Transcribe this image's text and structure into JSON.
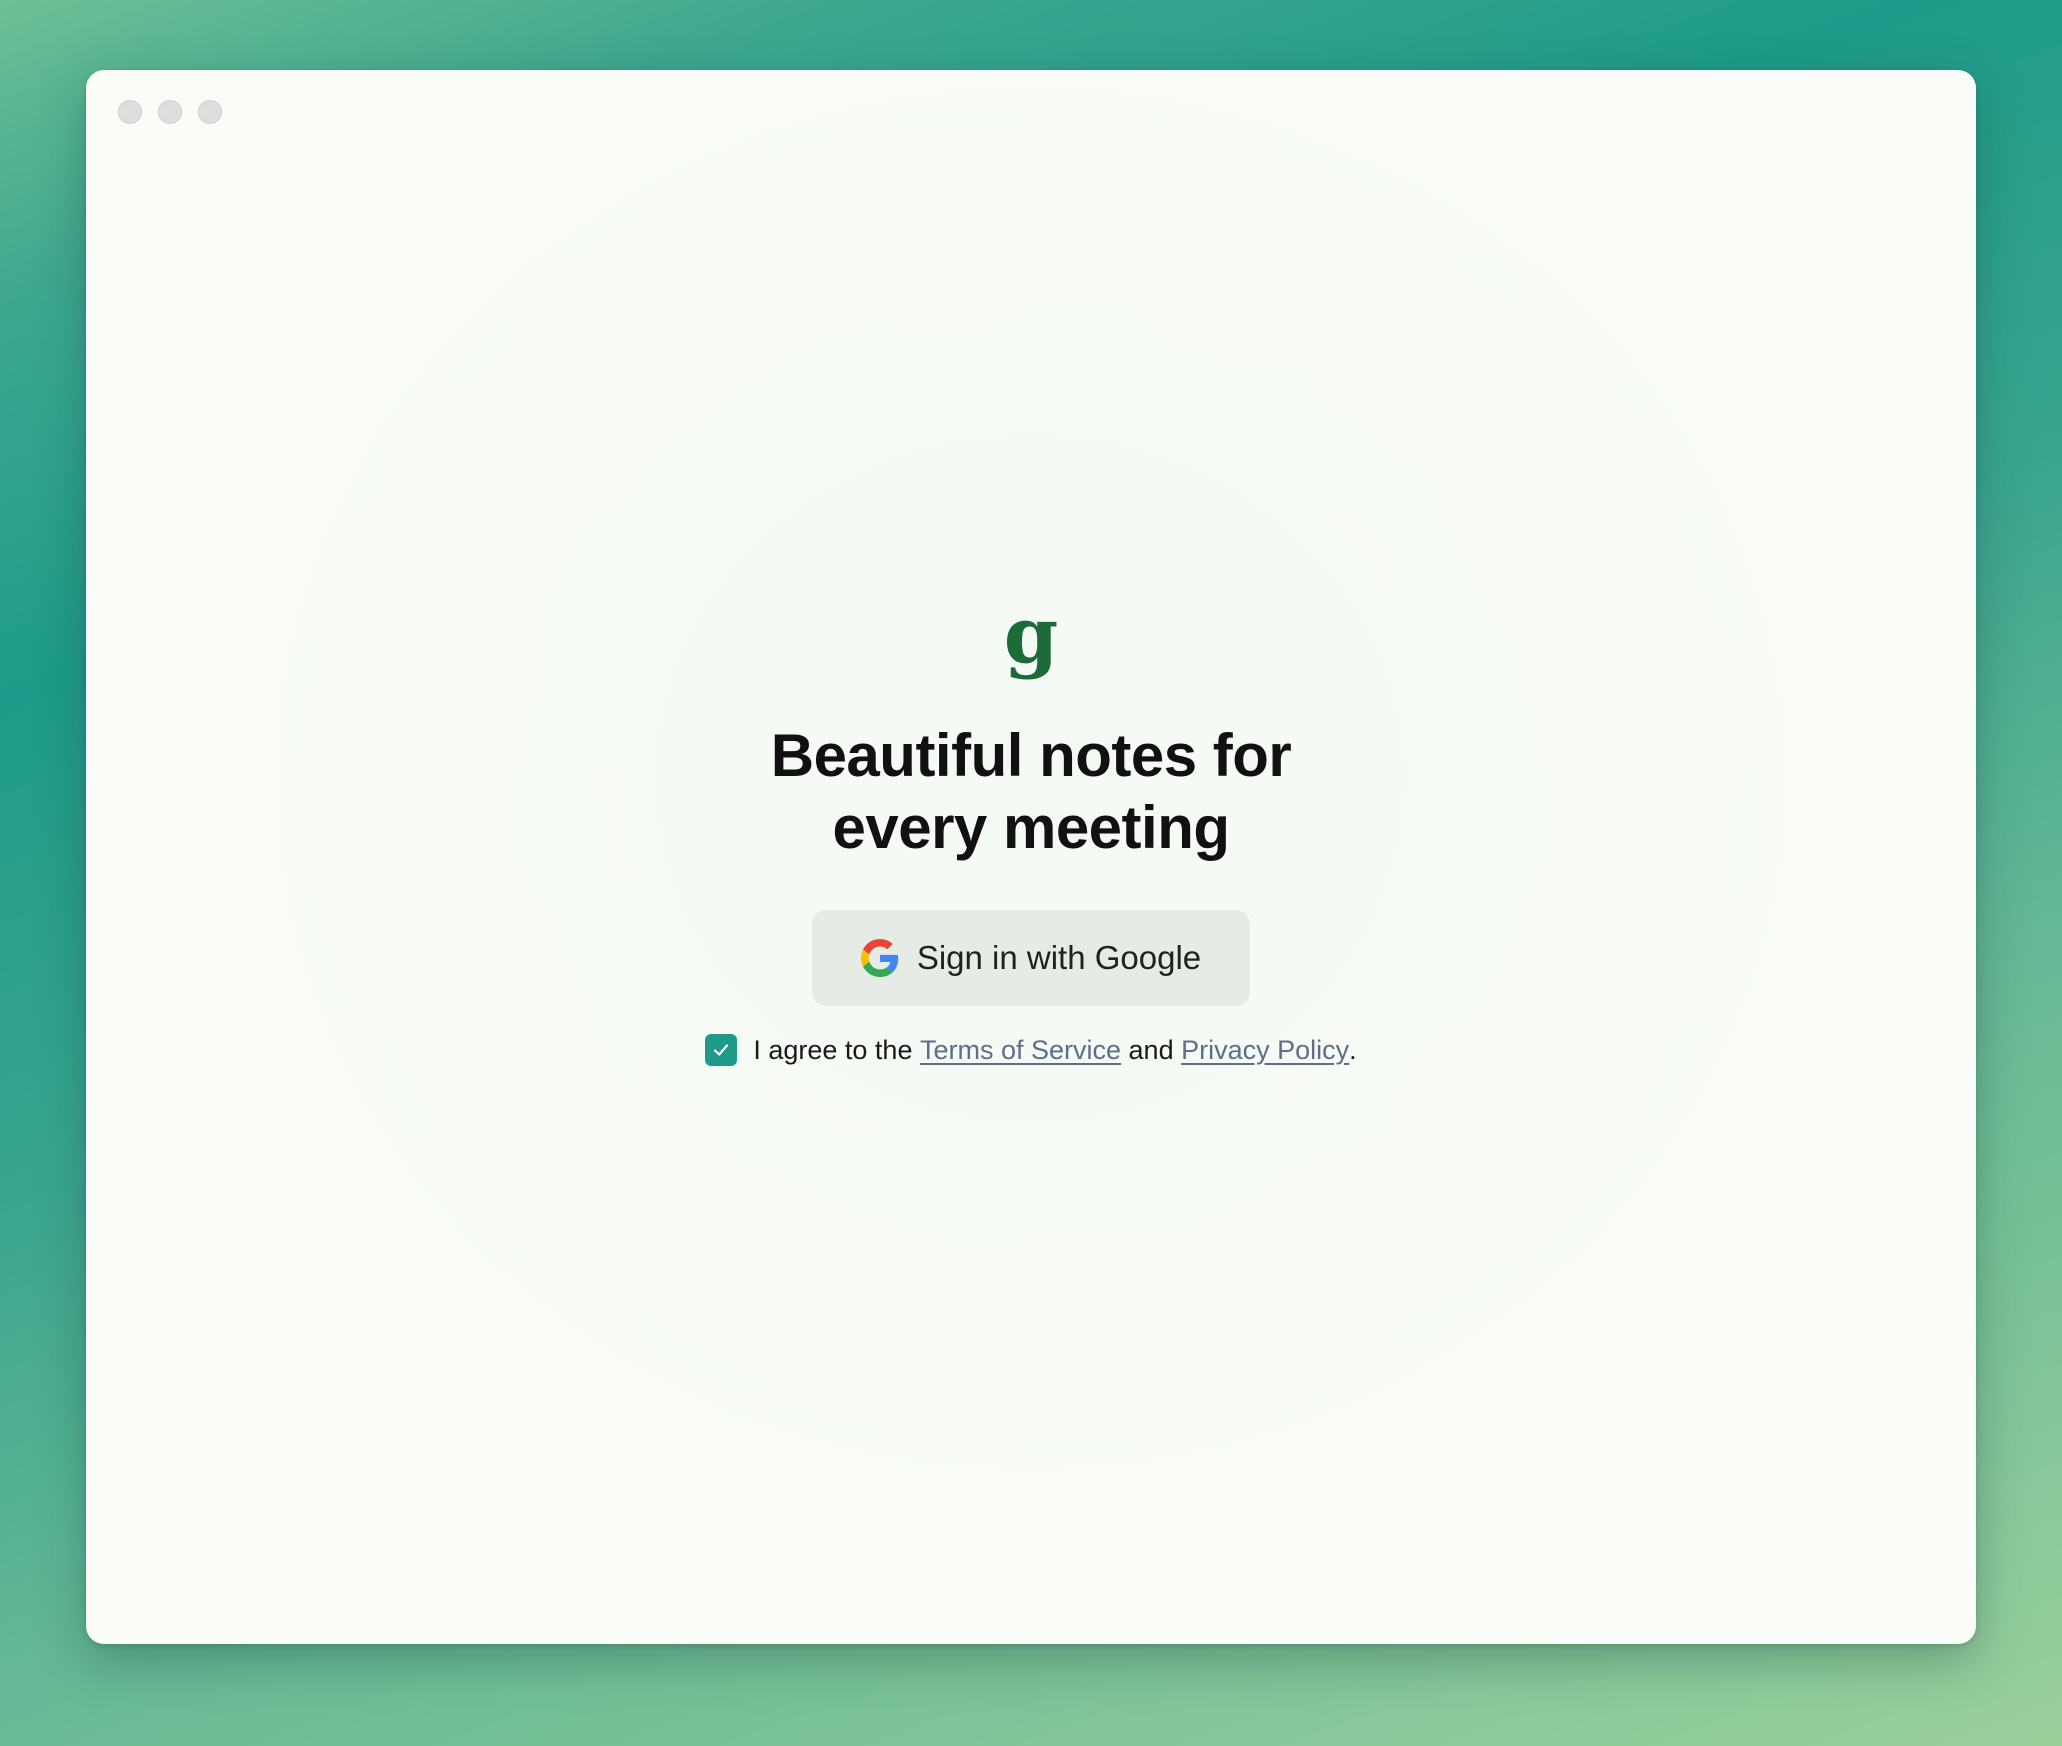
{
  "window": {
    "traffic_lights": [
      "close",
      "minimize",
      "zoom"
    ]
  },
  "brand": {
    "logo_icon": "granola-g-logo",
    "logo_color": "#1e6b3a"
  },
  "hero": {
    "title_line1": "Beautiful notes for",
    "title_line2": "every meeting"
  },
  "signin": {
    "button_label": "Sign in with Google",
    "icon": "google-g-icon"
  },
  "consent": {
    "checked": true,
    "checkbox_color": "#1f9a8a",
    "prefix": "I agree to the ",
    "terms_link": "Terms of Service",
    "middle": " and ",
    "privacy_link": "Privacy Policy",
    "suffix": "."
  }
}
